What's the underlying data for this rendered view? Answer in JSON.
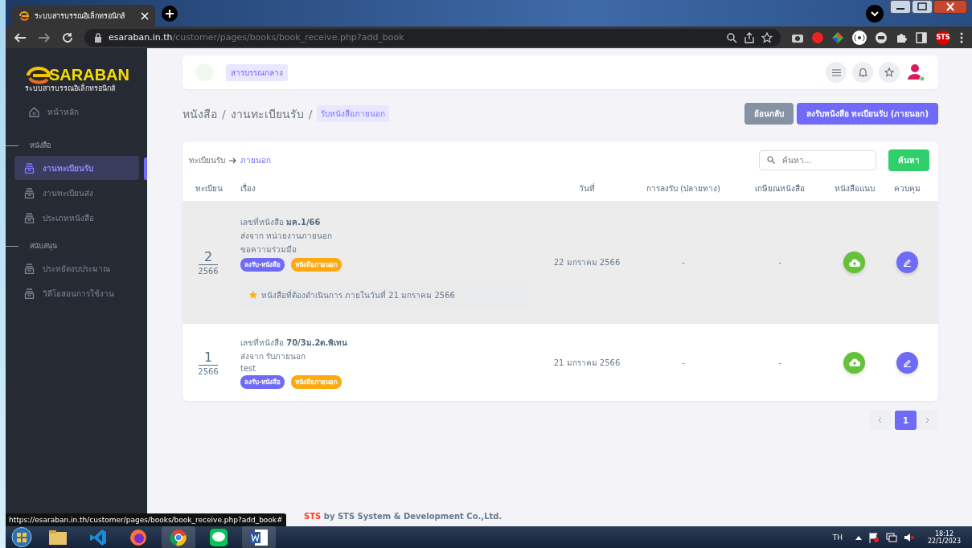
{
  "browser": {
    "tab_title": "ระบบสารบรรณอิเล็กทรอนิกส์",
    "url_host": "esaraban.in.th",
    "url_path": "/customer/pages/books/book_receive.php?add_book",
    "status_url": "https://esaraban.in.th/customer/pages/books/book_receive.php?add_book#",
    "extension_badge": "STS"
  },
  "sidebar": {
    "logo": "SARABAN",
    "logo_subtitle": "ระบบสารบรรณอิเล็กทรอนิกส์",
    "home": "หน้าหลัก",
    "sections": [
      {
        "title": "หนังสือ",
        "items": [
          {
            "label": "งานทะเบียนรับ",
            "selected": true
          },
          {
            "label": "งานทะเบียนส่ง",
            "selected": false
          },
          {
            "label": "ประเภทหนังสือ",
            "selected": false
          }
        ]
      },
      {
        "title": "สนับสนุน",
        "items": [
          {
            "label": "ประหยัดงบประมาณ",
            "selected": false
          },
          {
            "label": "วิดีโอสอนการใช้งาน",
            "selected": false
          }
        ]
      }
    ]
  },
  "topbar": {
    "org_badge": "สารบรรณกลาง"
  },
  "breadcrumb": {
    "items": [
      "หนังสือ",
      "งานทะเบียนรับ"
    ],
    "separator": "/",
    "current": "รับหนังสือภายนอก"
  },
  "actions": {
    "back": "ย้อนกลับ",
    "primary": "ลงรับหนังสือ ทะเบียนรับ (ภายนอก)"
  },
  "card": {
    "path": "ทะเบียนรับ",
    "path_current": "ภายนอก",
    "search": {
      "placeholder": "ค้นหา..."
    },
    "search_button": "ค้นหา",
    "columns": [
      "ทะเบียน",
      "เรื่อง",
      "วันที่",
      "การลงรับ (ปลายทาง)",
      "เกษียณหนังสือ",
      "หนังสือแนบ",
      "ควบคุม"
    ],
    "rows": [
      {
        "highlighted": true,
        "number": "2",
        "year": "2566",
        "doc_label": "เลขที่หนังสือ",
        "doc_no": "มค.1/66",
        "from": "ส่งจาก หน่วยงานภายนอก",
        "subject": "ขอความร่วมมือ",
        "tags": [
          {
            "label": "ลงรับ-หนังสือ",
            "color": "#6f6af8"
          },
          {
            "label": "หนังสือภายนอก",
            "color": "#fda90f"
          }
        ],
        "note": "หนังสือที่ต้องดำเนินการ ภายในวันที่ 21 มกราคม 2566",
        "date": "22 มกราคม 2566",
        "received": "-",
        "endorsed": "-"
      },
      {
        "highlighted": false,
        "number": "1",
        "year": "2566",
        "doc_label": "เลขที่หนังสือ",
        "doc_no": "70/3ม.2ต.พิเทน",
        "from": "ส่งจาก รับภายนอก",
        "subject": "test",
        "tags": [
          {
            "label": "ลงรับ-หนังสือ",
            "color": "#6f6af8"
          },
          {
            "label": "หนังสือภายนอก",
            "color": "#fda90f"
          }
        ],
        "date": "21 มกราคม 2566",
        "received": "-",
        "endorsed": "-"
      }
    ]
  },
  "pagination": [
    {
      "label": "1",
      "selected": true
    }
  ],
  "footer": {
    "brand": "STS",
    "text": "by STS System & Development Co.,Ltd."
  },
  "taskbar": {
    "language": "TH",
    "time": "18:12",
    "date": "22/1/2023"
  }
}
